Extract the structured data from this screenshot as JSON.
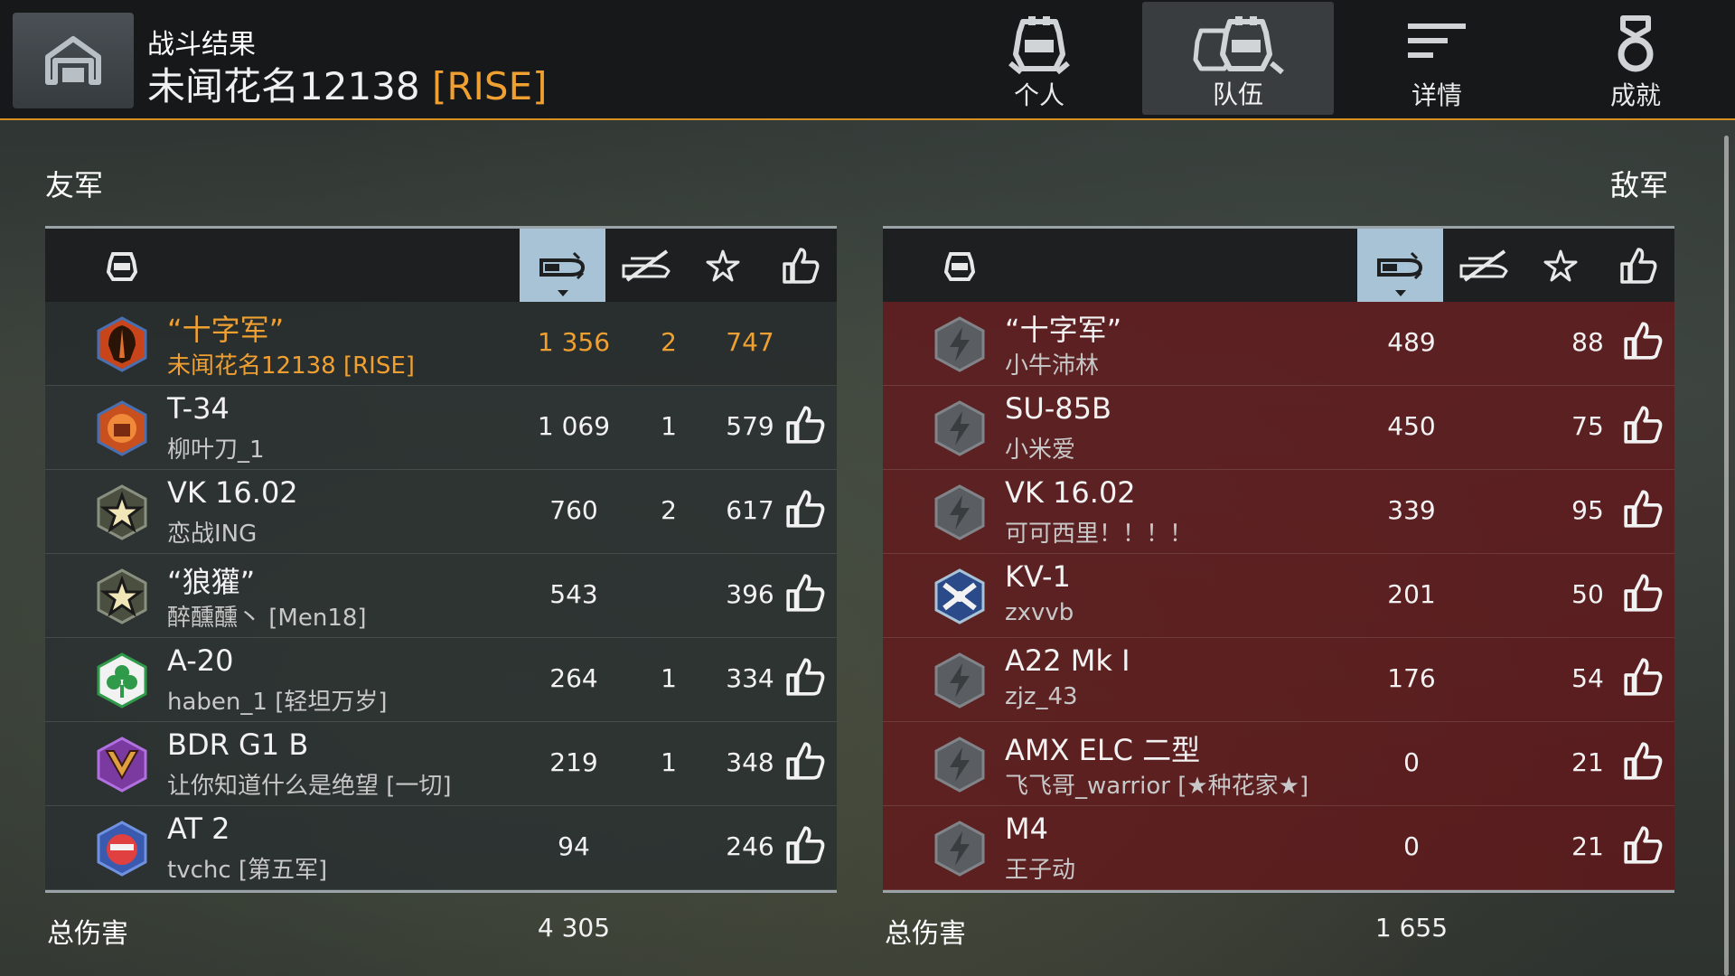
{
  "header": {
    "subtitle": "战斗结果",
    "player_name": "未闻花名12138",
    "clan_tag": "[RISE]",
    "tabs": [
      {
        "label": "个人",
        "active": false
      },
      {
        "label": "队伍",
        "active": true
      },
      {
        "label": "详情",
        "active": false
      },
      {
        "label": "成就",
        "active": false
      }
    ]
  },
  "allies": {
    "title": "友军",
    "total_label": "总伤害",
    "total_damage": "4 305",
    "rows": [
      {
        "tank": "“十字军”",
        "player": "未闻花名12138 [RISE]",
        "damage": "1 356",
        "kills": "2",
        "xp": "747",
        "thumb": false,
        "badge": "helmet-badge-icon"
      },
      {
        "tank": "T-34",
        "player": "柳叶刀_1",
        "damage": "1 069",
        "kills": "1",
        "xp": "579",
        "thumb": true,
        "badge": "fist-badge-icon"
      },
      {
        "tank": "VK 16.02",
        "player": "恋战ING",
        "damage": "760",
        "kills": "2",
        "xp": "617",
        "thumb": true,
        "badge": "star-badge-icon"
      },
      {
        "tank": "“狼獾”",
        "player": "醉醺醺丶 [Men18]",
        "damage": "543",
        "kills": "",
        "xp": "396",
        "thumb": true,
        "badge": "star-badge-icon"
      },
      {
        "tank": "A-20",
        "player": "haben_1 [轻坦万岁]",
        "damage": "264",
        "kills": "1",
        "xp": "334",
        "thumb": true,
        "badge": "clover-badge-icon"
      },
      {
        "tank": "BDR G1 B",
        "player": "让你知道什么是绝望 [一切]",
        "damage": "219",
        "kills": "1",
        "xp": "348",
        "thumb": true,
        "badge": "chevron-badge-icon"
      },
      {
        "tank": "AT 2",
        "player": "tvchc [第五军]",
        "damage": "94",
        "kills": "",
        "xp": "246",
        "thumb": true,
        "badge": "face-badge-icon"
      }
    ]
  },
  "enemies": {
    "title": "敌军",
    "total_label": "总伤害",
    "total_damage": "1 655",
    "rows": [
      {
        "tank": "“十字军”",
        "player": "小牛沛林",
        "damage": "489",
        "kills": "",
        "xp": "88",
        "thumb": true,
        "badge": "lightning-badge-icon"
      },
      {
        "tank": "SU-85B",
        "player": "小米爱",
        "damage": "450",
        "kills": "",
        "xp": "75",
        "thumb": true,
        "badge": "lightning-badge-icon"
      },
      {
        "tank": "VK 16.02",
        "player": "可可西里！！！！",
        "damage": "339",
        "kills": "",
        "xp": "95",
        "thumb": true,
        "badge": "lightning-badge-icon"
      },
      {
        "tank": "KV-1",
        "player": "zxvvb",
        "damage": "201",
        "kills": "",
        "xp": "50",
        "thumb": true,
        "badge": "guns-badge-icon"
      },
      {
        "tank": "A22 Mk I",
        "player": "zjz_43",
        "damage": "176",
        "kills": "",
        "xp": "54",
        "thumb": true,
        "badge": "lightning-badge-icon"
      },
      {
        "tank": "AMX ELC 二型",
        "player": "飞飞哥_warrior [★种花家★]",
        "damage": "0",
        "kills": "",
        "xp": "21",
        "thumb": true,
        "badge": "lightning-badge-icon"
      },
      {
        "tank": "M4",
        "player": "王子动",
        "damage": "0",
        "kills": "",
        "xp": "21",
        "thumb": true,
        "badge": "lightning-badge-icon"
      }
    ]
  },
  "colors": {
    "accent": "#f0a030",
    "sorted_column": "#a8c2d6",
    "ally_row": "#2c3234",
    "enemy_row": "#64161a"
  }
}
